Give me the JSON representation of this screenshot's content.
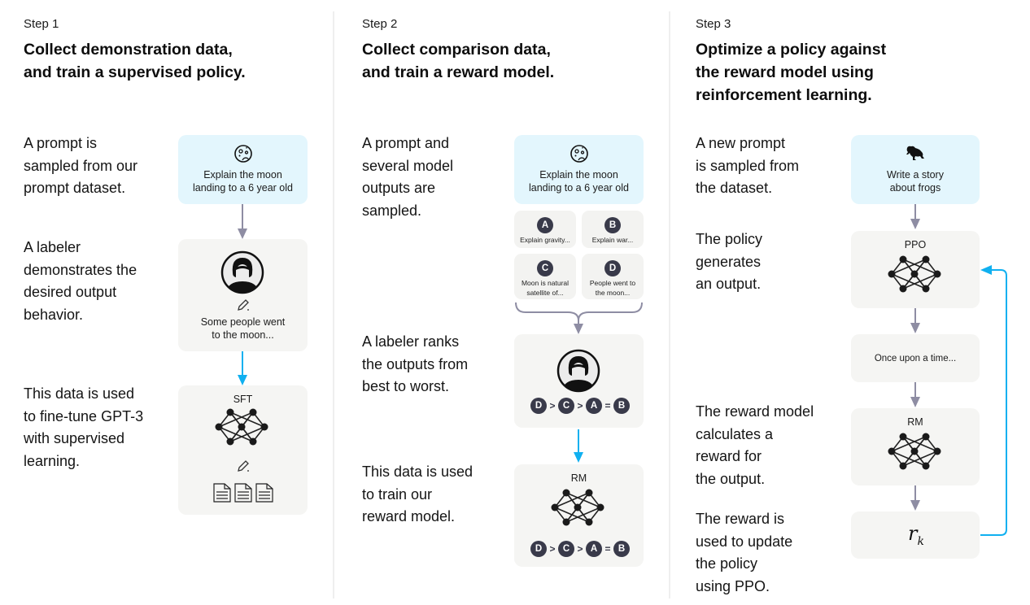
{
  "colors": {
    "prompt_card": "#e3f6fd",
    "card": "#f5f5f3",
    "gray_arrow": "#8e8da3",
    "blue_arrow": "#10b0f0",
    "badge": "#393a4a",
    "divider": "#efefef"
  },
  "steps": [
    {
      "label": "Step 1",
      "title": [
        "Collect demonstration data,",
        "and train a supervised policy."
      ],
      "descriptions": [
        [
          "A prompt is",
          "sampled from our",
          "prompt dataset."
        ],
        [
          "A labeler",
          "demonstrates the",
          "desired output",
          "behavior."
        ],
        [
          "This data is used",
          "to fine-tune GPT-3",
          "with supervised",
          "learning."
        ]
      ],
      "prompt_card": {
        "icon": "moon-icon",
        "text": [
          "Explain the moon",
          "landing to a 6 year old"
        ]
      },
      "labeler_card": {
        "icon": "labeler-avatar",
        "edit_icon": "pencil-icon",
        "text": [
          "Some people went",
          "to the moon..."
        ]
      },
      "model_card": {
        "title": "SFT",
        "icon": "neural-network-icon",
        "edit_icon": "pencil-icon",
        "doc_icons": [
          "document-icon",
          "document-icon",
          "document-icon"
        ]
      }
    },
    {
      "label": "Step 2",
      "title": [
        "Collect comparison data,",
        "and train a reward model."
      ],
      "descriptions": [
        [
          "A prompt and",
          "several model",
          "outputs are",
          "sampled."
        ],
        [
          "A labeler ranks",
          "the outputs from",
          "best to worst."
        ],
        [
          "This data is used",
          "to train our",
          "reward model."
        ]
      ],
      "prompt_card": {
        "icon": "moon-icon",
        "text": [
          "Explain the moon",
          "landing to a 6 year old"
        ]
      },
      "outputs": [
        {
          "badge": "A",
          "text": [
            "Explain gravity..."
          ]
        },
        {
          "badge": "B",
          "text": [
            "Explain war..."
          ]
        },
        {
          "badge": "C",
          "text": [
            "Moon is natural",
            "satellite of..."
          ]
        },
        {
          "badge": "D",
          "text": [
            "People went to",
            "the moon..."
          ]
        }
      ],
      "ranking": {
        "items": [
          "D",
          "C",
          "A",
          "B"
        ],
        "ops": [
          ">",
          ">",
          "="
        ]
      },
      "model_card": {
        "title": "RM",
        "icon": "neural-network-icon"
      }
    },
    {
      "label": "Step 3",
      "title": [
        "Optimize a policy against",
        "the reward model using",
        "reinforcement learning."
      ],
      "descriptions": [
        [
          "A new prompt",
          "is sampled from",
          "the dataset."
        ],
        [
          "The policy",
          "generates",
          "an output."
        ],
        [
          "The reward model",
          "calculates a",
          "reward for",
          "the output."
        ],
        [
          "The reward is",
          "used to update",
          "the policy",
          "using PPO."
        ]
      ],
      "prompt_card": {
        "icon": "frog-icon",
        "text": [
          "Write a story",
          "about frogs"
        ]
      },
      "policy_card": {
        "title": "PPO",
        "icon": "neural-network-icon"
      },
      "output_card": {
        "text": "Once upon a time..."
      },
      "reward_model_card": {
        "title": "RM",
        "icon": "neural-network-icon"
      },
      "reward_card": {
        "symbol": "r",
        "subscript": "k"
      }
    }
  ]
}
